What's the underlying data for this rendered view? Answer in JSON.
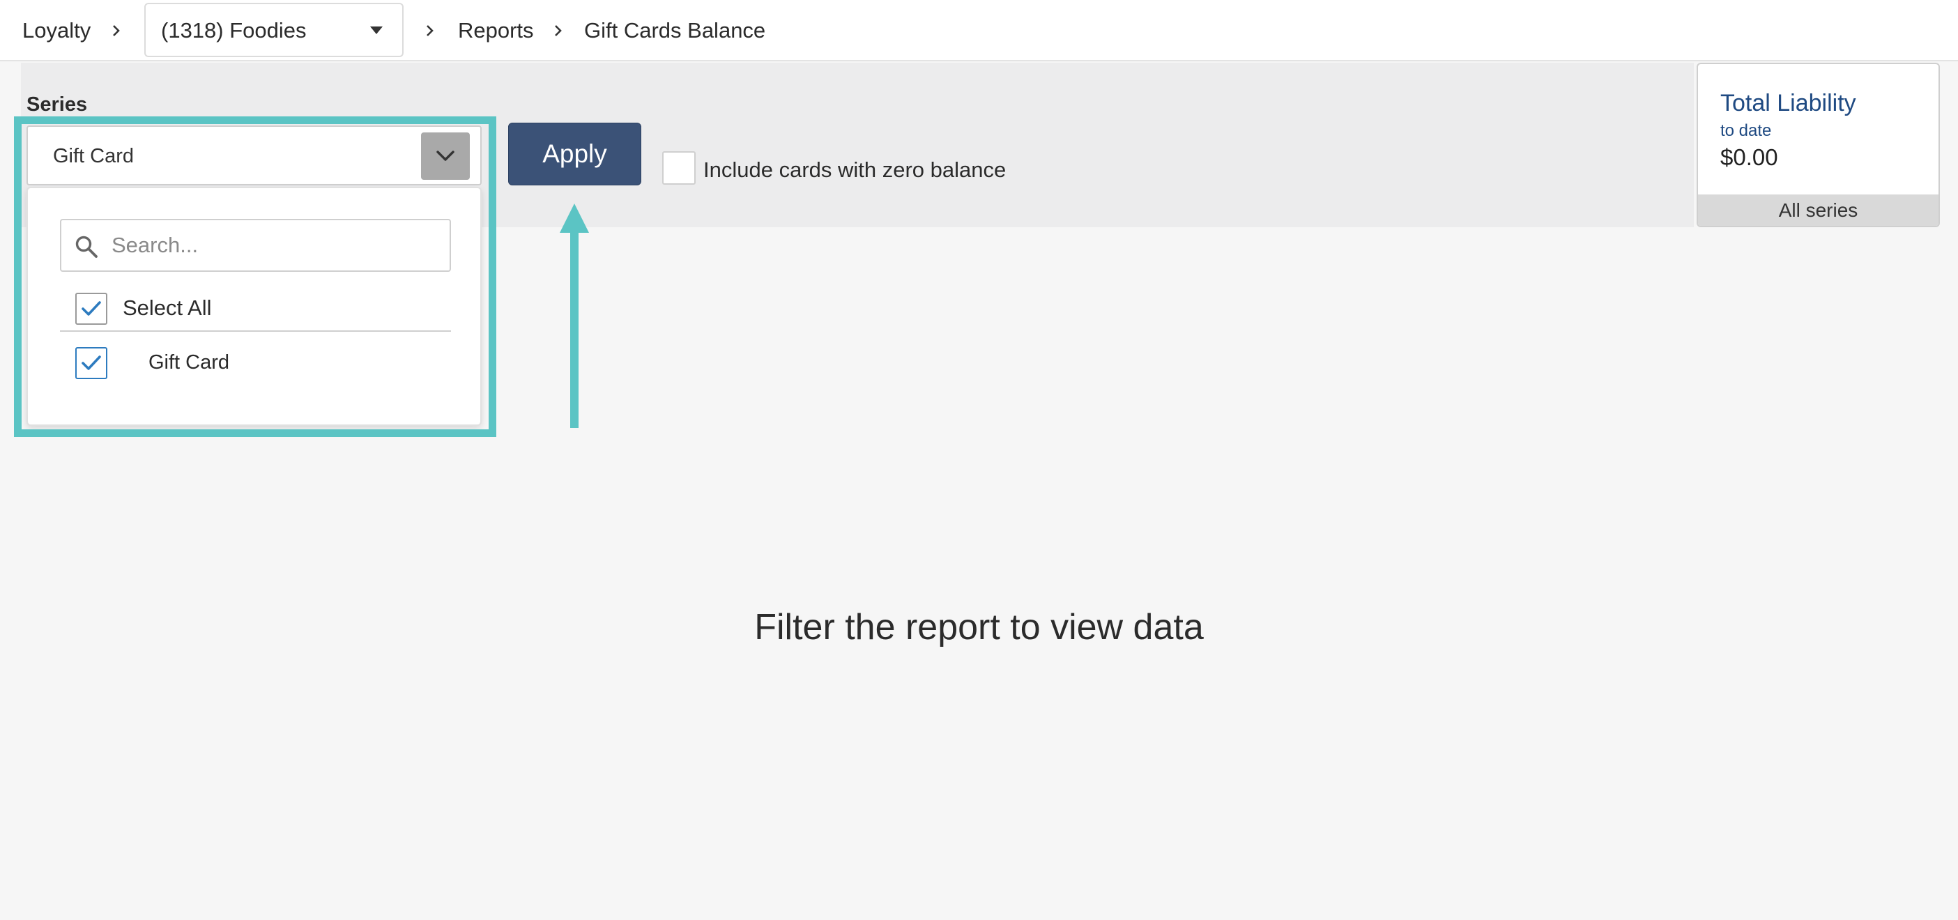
{
  "breadcrumb": {
    "root": "Loyalty",
    "location": "(1318) Foodies",
    "section": "Reports",
    "page": "Gift Cards Balance"
  },
  "filters": {
    "series_label": "Series",
    "series_selected": "Gift Card",
    "search_placeholder": "Search...",
    "select_all_label": "Select All",
    "options": [
      "Gift Card"
    ],
    "apply_label": "Apply",
    "zero_balance_label": "Include cards with zero balance"
  },
  "liability": {
    "title": "Total Liability",
    "subtitle": "to date",
    "amount": "$0.00",
    "footer": "All series"
  },
  "empty_state": "Filter the report to view data",
  "colors": {
    "highlight": "#5bc4c4",
    "apply_bg": "#3b5277",
    "accent_blue": "#1f4a82",
    "checkbox_blue": "#2d7bbf"
  },
  "icons": {
    "breadcrumb_separator": "chevron-right-icon",
    "select_toggle": "chevron-down-icon",
    "search": "search-icon",
    "check": "checkmark-icon"
  }
}
